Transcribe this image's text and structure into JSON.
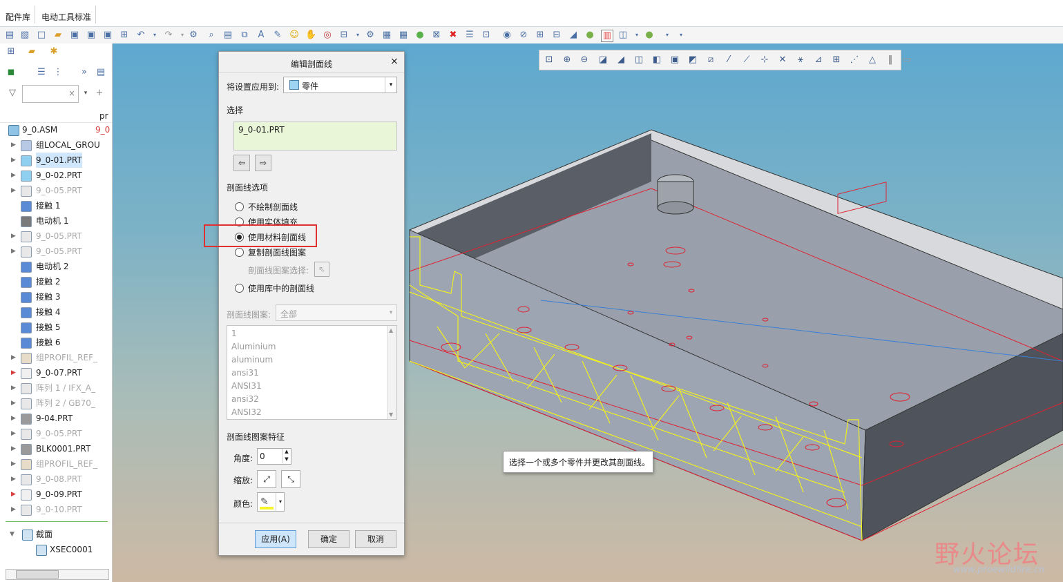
{
  "tabs": [
    "配件库",
    "电动工具标准"
  ],
  "left_panel": {
    "column_header": "pr",
    "root": {
      "label": "9_0.ASM",
      "suffix": "9_0"
    },
    "items": [
      {
        "label": "组LOCAL_GROU",
        "dim": false,
        "selected": false
      },
      {
        "label": "9_0-01.PRT",
        "dim": false,
        "selected": true
      },
      {
        "label": "9_0-02.PRT",
        "dim": false,
        "selected": false
      },
      {
        "label": "9_0-05.PRT",
        "dim": true,
        "selected": false
      },
      {
        "label": "接触 1",
        "dim": false,
        "selected": false
      },
      {
        "label": "电动机 1",
        "dim": false,
        "selected": false
      },
      {
        "label": "9_0-05.PRT",
        "dim": true,
        "selected": false
      },
      {
        "label": "9_0-05.PRT",
        "dim": true,
        "selected": false
      },
      {
        "label": "电动机 2",
        "dim": false,
        "selected": false
      },
      {
        "label": "接触 2",
        "dim": false,
        "selected": false
      },
      {
        "label": "接触 3",
        "dim": false,
        "selected": false
      },
      {
        "label": "接触 4",
        "dim": false,
        "selected": false
      },
      {
        "label": "接触 5",
        "dim": false,
        "selected": false
      },
      {
        "label": "接触 6",
        "dim": false,
        "selected": false
      },
      {
        "label": "组PROFIL_REF_",
        "dim": true,
        "selected": false
      },
      {
        "label": "9_0-07.PRT",
        "dim": false,
        "selected": false
      },
      {
        "label": "阵列 1 / IFX_A_",
        "dim": true,
        "selected": false
      },
      {
        "label": "阵列 2 / GB70_",
        "dim": true,
        "selected": false
      },
      {
        "label": "9-04.PRT",
        "dim": false,
        "selected": false
      },
      {
        "label": "9_0-05.PRT",
        "dim": true,
        "selected": false
      },
      {
        "label": "BLK0001.PRT",
        "dim": false,
        "selected": false
      },
      {
        "label": "组PROFIL_REF_",
        "dim": true,
        "selected": false
      },
      {
        "label": "9_0-08.PRT",
        "dim": true,
        "selected": false
      },
      {
        "label": "9_0-09.PRT",
        "dim": false,
        "selected": false
      },
      {
        "label": "9_0-10.PRT",
        "dim": true,
        "selected": false
      }
    ],
    "section_group": {
      "label": "截面",
      "child": "XSEC0001"
    }
  },
  "dialog": {
    "title": "编辑剖面线",
    "apply_to_label": "将设置应用到:",
    "apply_to_value": "零件",
    "select_header": "选择",
    "selected_item": "9_0-01.PRT",
    "options_header": "剖面线选项",
    "options": [
      "不绘制剖面线",
      "使用实体填充",
      "使用材料剖面线",
      "复制剖面线图案",
      "使用库中的剖面线"
    ],
    "selected_option": 2,
    "pattern_select_label": "剖面线图案选择:",
    "pattern_label": "剖面线图案:",
    "pattern_value": "全部",
    "patterns": [
      "1",
      "Aluminium",
      "aluminum",
      "ansi31",
      "ANSI31",
      "ansi32",
      "ANSI32"
    ],
    "features_header": "剖面线图案特征",
    "angle_label": "角度:",
    "angle_value": "0",
    "scale_label": "缩放:",
    "color_label": "颜色:",
    "color_value": "#f5f52a",
    "apply_button": "应用(A)",
    "ok_button": "确定",
    "cancel_button": "取消"
  },
  "tooltip": "选择一个或多个零件并更改其剖面线。",
  "watermark": {
    "main": "野火论坛",
    "url": "www.proewildfire.cn"
  }
}
